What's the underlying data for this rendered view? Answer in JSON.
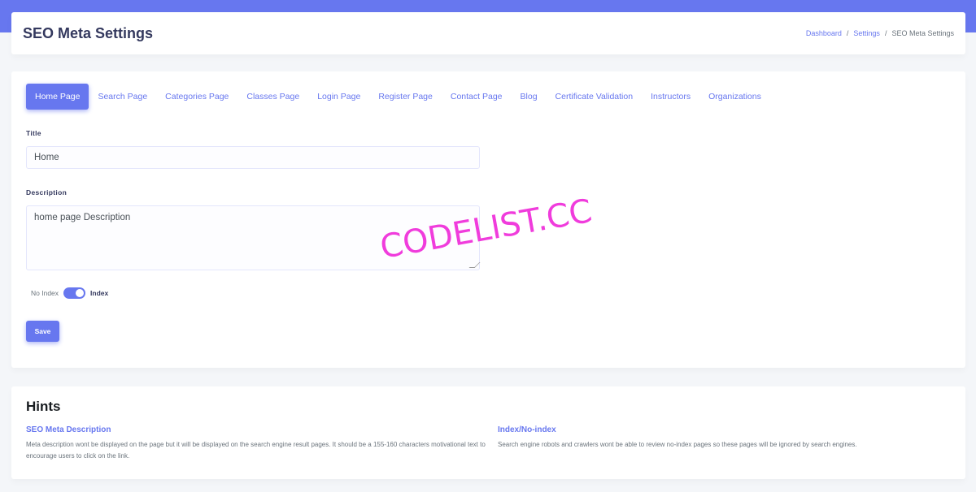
{
  "header": {
    "title": "SEO Meta Settings",
    "breadcrumb": [
      "Dashboard",
      "Settings",
      "SEO Meta Settings"
    ]
  },
  "tabs": [
    {
      "label": "Home Page",
      "active": true
    },
    {
      "label": "Search Page"
    },
    {
      "label": "Categories Page"
    },
    {
      "label": "Classes Page"
    },
    {
      "label": "Login Page"
    },
    {
      "label": "Register Page"
    },
    {
      "label": "Contact Page"
    },
    {
      "label": "Blog"
    },
    {
      "label": "Certificate Validation"
    },
    {
      "label": "Instructors"
    },
    {
      "label": "Organizations"
    }
  ],
  "form": {
    "title_label": "Title",
    "title_value": "Home",
    "description_label": "Description",
    "description_value": "home page Description",
    "toggle_off_label": "No Index",
    "toggle_on_label": "Index",
    "toggle_state": "on",
    "save_label": "Save"
  },
  "watermark": "CODELIST.CC",
  "hints": {
    "title": "Hints",
    "items": [
      {
        "title": "SEO Meta Description",
        "text": "Meta description wont be displayed on the page but it will be displayed on the search engine result pages. It should be a 155-160 characters motivational text to encourage users to click on the link."
      },
      {
        "title": "Index/No-index",
        "text": "Search engine robots and crawlers wont be able to review no-index pages so these pages will be ignored by search engines."
      }
    ]
  },
  "colors": {
    "primary": "#6777ef",
    "background": "#f4f6f9",
    "watermark": "#f03cdc"
  }
}
